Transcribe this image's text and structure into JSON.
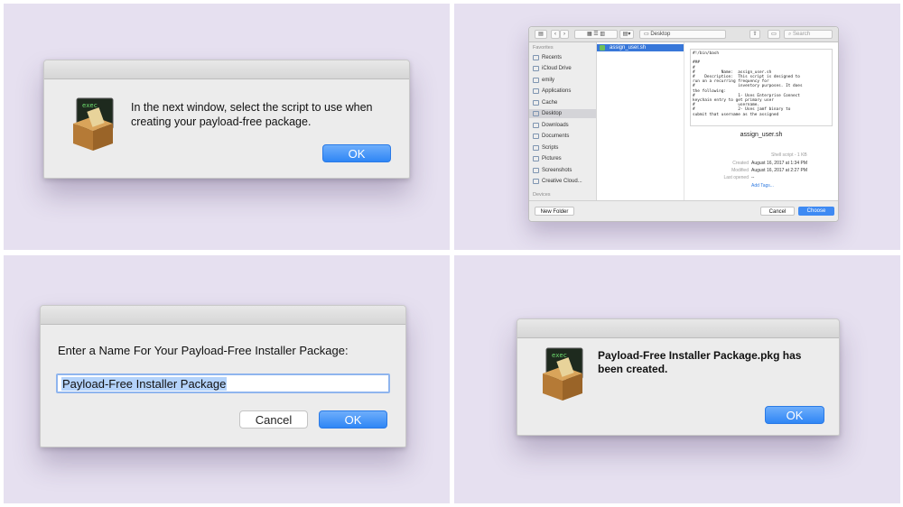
{
  "dialog_select_script": {
    "message": "In the next window, select the script to use when creating your payload-free package.",
    "ok_label": "OK"
  },
  "finder_dialog": {
    "location": "Desktop",
    "search_placeholder": "Search",
    "sidebar": {
      "favorites_heading": "Favorites",
      "items": [
        "Recents",
        "iCloud Drive",
        "emily",
        "Applications",
        "Cache",
        "Desktop",
        "Downloads",
        "Documents",
        "Scripts",
        "Pictures",
        "Screenshots",
        "Creative Cloud..."
      ],
      "selected": "Desktop",
      "devices_heading": "Devices"
    },
    "selected_file": "assign_user.sh",
    "preview_text": "#!/bin/bash\n\n###\n#\n#           Name:  assign_user.sh\n#    Description:  This script is designed to\nrun on a recurring frequency for\n#                  inventory purposes. It does\nthe following:\n#                  1- Uses Enterprise Connect\nkeychain entry to get primary user\n#                  username.\n#                  2- Uses jamf binary to\nsubmit that username as the assigned",
    "file_name": "assign_user.sh",
    "kind_size": "Shell script - 1 KB",
    "info": [
      {
        "label": "Created",
        "value": "August 16, 2017 at 1:34 PM"
      },
      {
        "label": "Modified",
        "value": "August 16, 2017 at 2:27 PM"
      },
      {
        "label": "Last opened",
        "value": "--"
      }
    ],
    "add_tags": "Add Tags...",
    "new_folder_label": "New Folder",
    "cancel_label": "Cancel",
    "choose_label": "Choose"
  },
  "dialog_name": {
    "prompt": "Enter a Name For Your Payload-Free Installer Package:",
    "value": "Payload-Free Installer Package",
    "cancel_label": "Cancel",
    "ok_label": "OK"
  },
  "dialog_created": {
    "message": "Payload-Free Installer Package.pkg has been created.",
    "ok_label": "OK"
  },
  "icon": {
    "badge_text": "exec"
  },
  "colors": {
    "accent": "#2f86f5",
    "background": "#e6e0f0"
  }
}
